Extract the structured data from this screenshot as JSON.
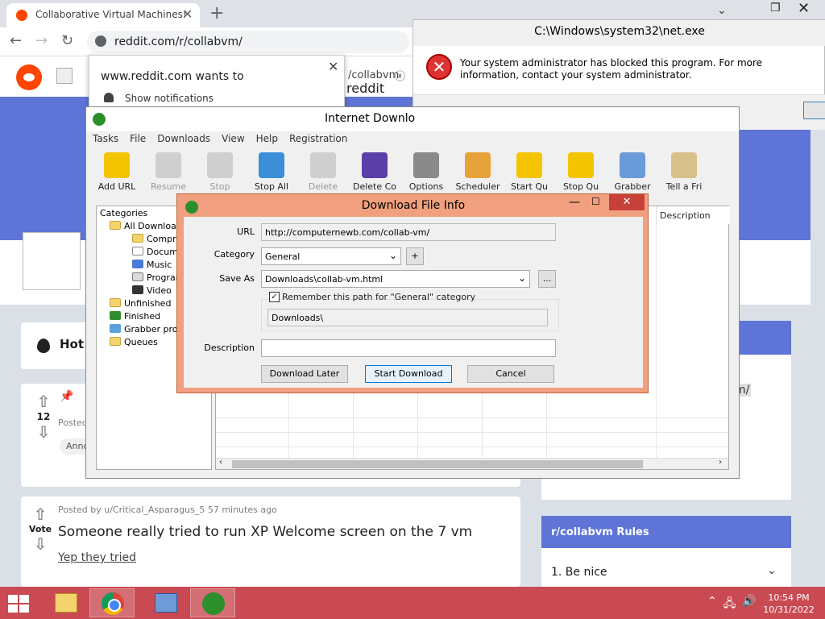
{
  "browser": {
    "tab_title": "Collaborative Virtual Machines!",
    "url": "reddit.com/r/collabvm/",
    "bg_tab_text": "/collabvm",
    "bg_reddit_text": "reddit"
  },
  "notification": {
    "title": "www.reddit.com wants to",
    "item": "Show notifications"
  },
  "netexe": {
    "title": "C:\\Windows\\system32\\net.exe",
    "message": "Your system administrator has blocked this program. For more information, contact your system administrator.",
    "icon": "error-icon"
  },
  "reddit": {
    "sort_hot": "Hot",
    "post1": {
      "score": "12",
      "posted": "Posted",
      "badge": "Anno"
    },
    "post2": {
      "vote": "Vote",
      "meta": "Posted by u/Critical_Asparagus_5 57 minutes ago",
      "title": "Someone really tried to run XP Welcome screen on the 7 vm",
      "link": "Yep they tried"
    },
    "sidebar_partial": "m/",
    "rules_title": "r/collabvm Rules",
    "rule1": "1. Be nice"
  },
  "idm": {
    "title": "Internet Downlo",
    "menu": [
      "Tasks",
      "File",
      "Downloads",
      "View",
      "Help",
      "Registration"
    ],
    "toolbar": [
      {
        "label": "Add URL",
        "icon": "add-url-icon",
        "color": "#f5c400",
        "enabled": true
      },
      {
        "label": "Resume",
        "icon": "resume-icon",
        "color": "#cfcfcf",
        "enabled": false
      },
      {
        "label": "Stop",
        "icon": "stop-icon",
        "color": "#cfcfcf",
        "enabled": false
      },
      {
        "label": "Stop All",
        "icon": "stop-all-icon",
        "color": "#3a8fd8",
        "enabled": true
      },
      {
        "label": "Delete",
        "icon": "delete-icon",
        "color": "#cfcfcf",
        "enabled": false
      },
      {
        "label": "Delete Co",
        "icon": "delete-completed-icon",
        "color": "#5a3fa8",
        "enabled": true
      },
      {
        "label": "Options",
        "icon": "options-icon",
        "color": "#8a8a8a",
        "enabled": true
      },
      {
        "label": "Scheduler",
        "icon": "scheduler-icon",
        "color": "#e8a23a",
        "enabled": true
      },
      {
        "label": "Start Qu",
        "icon": "start-queue-icon",
        "color": "#f5c400",
        "enabled": true
      },
      {
        "label": "Stop Qu",
        "icon": "stop-queue-icon",
        "color": "#f5c400",
        "enabled": true
      },
      {
        "label": "Grabber",
        "icon": "grabber-icon",
        "color": "#6a9ad8",
        "enabled": true
      },
      {
        "label": "Tell a Fri",
        "icon": "tell-friend-icon",
        "color": "#d8c08a",
        "enabled": true
      }
    ],
    "tree": {
      "title": "Categories",
      "items": [
        "All Downloa",
        "Compre",
        "Docume",
        "Music",
        "Program",
        "Video",
        "Unfinished",
        "Finished",
        "Grabber pro",
        "Queues"
      ]
    },
    "list_desc_header": "Description"
  },
  "dfi": {
    "title": "Download File Info",
    "url_label": "URL",
    "url_value": "http://computernewb.com/collab-vm/",
    "category_label": "Category",
    "category_value": "General",
    "add_label": "+",
    "saveas_label": "Save As",
    "saveas_value": "Downloads\\collab-vm.html",
    "browse_label": "...",
    "remember_label": "Remember this path for \"General\" category",
    "path_value": "Downloads\\",
    "description_label": "Description",
    "description_value": "",
    "download_later": "Download Later",
    "start_download": "Start Download",
    "cancel": "Cancel"
  },
  "taskbar": {
    "time": "10:54 PM",
    "date": "10/31/2022"
  }
}
